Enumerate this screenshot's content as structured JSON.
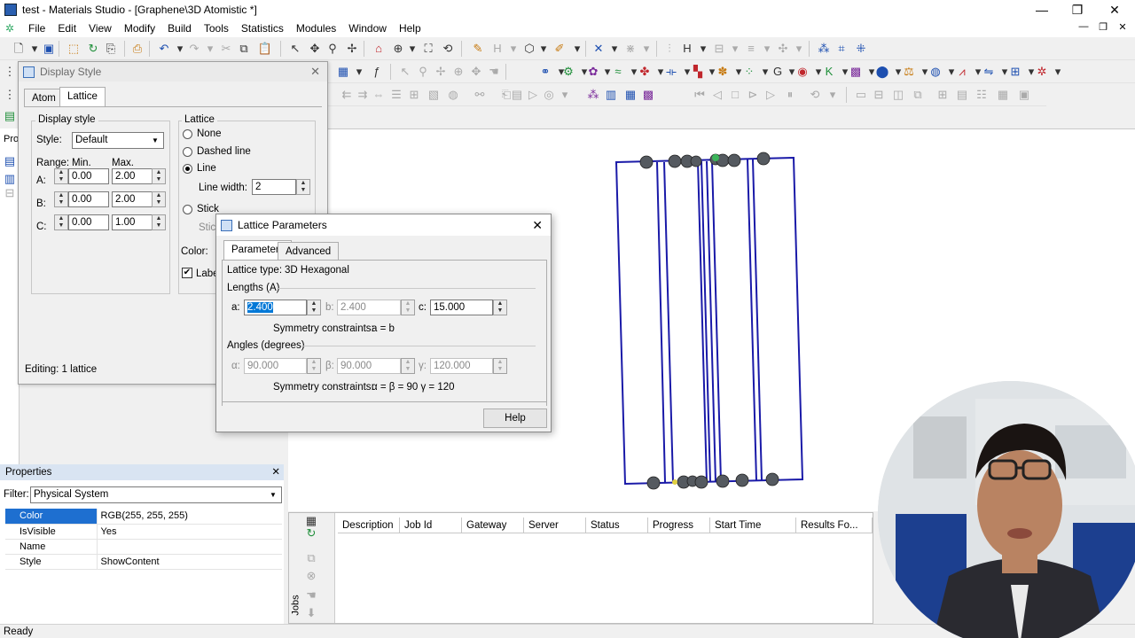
{
  "window": {
    "title": "test - Materials Studio - [Graphene\\3D Atomistic *]"
  },
  "menu": [
    "File",
    "Edit",
    "View",
    "Modify",
    "Build",
    "Tools",
    "Statistics",
    "Modules",
    "Window",
    "Help"
  ],
  "display_style": {
    "title": "Display Style",
    "tabs": [
      "Atom",
      "Lattice"
    ],
    "active_tab": "Lattice",
    "display_style_group": "Display style",
    "style_label": "Style:",
    "style_value": "Default",
    "range_label": "Range:",
    "min_label": "Min.",
    "max_label": "Max.",
    "ranges": [
      {
        "axis": "A:",
        "min": "0.00",
        "max": "2.00"
      },
      {
        "axis": "B:",
        "min": "0.00",
        "max": "2.00"
      },
      {
        "axis": "C:",
        "min": "0.00",
        "max": "1.00"
      }
    ],
    "lattice_group": "Lattice",
    "options": [
      "None",
      "Dashed line",
      "Line",
      "Stick"
    ],
    "selected_option": "Line",
    "line_width_label": "Line width:",
    "line_width": "2",
    "stick_label": "Stic",
    "color_label": "Color:",
    "label_check": "Labe",
    "editing": "Editing: 1 lattice"
  },
  "lattice_params": {
    "title": "Lattice Parameters",
    "tabs": [
      "Parameters",
      "Advanced"
    ],
    "active_tab": "Parameters",
    "lattice_type_label": "Lattice type:",
    "lattice_type": "3D Hexagonal",
    "lengths_label": "Lengths (A)",
    "a_label": "a:",
    "a": "2.400",
    "b_label": "b:",
    "b": "2.400",
    "c_label": "c:",
    "c": "15.000",
    "sym_label": "Symmetry constraints:",
    "sym_lengths": "a = b",
    "angles_label": "Angles (degrees)",
    "alpha_label": "α:",
    "alpha": "90.000",
    "beta_label": "β:",
    "beta": "90.000",
    "gamma_label": "γ:",
    "gamma": "120.000",
    "sym_angles": "α = β = 90  γ = 120",
    "help": "Help"
  },
  "properties": {
    "title": "Properties",
    "filter_label": "Filter:",
    "filter_value": "Physical System",
    "rows": [
      {
        "key": "Color",
        "value": "RGB(255, 255, 255)"
      },
      {
        "key": "IsVisible",
        "value": "Yes"
      },
      {
        "key": "Name",
        "value": ""
      },
      {
        "key": "Style",
        "value": "ShowContent"
      }
    ]
  },
  "left_pane": {
    "pro_label": "Pro"
  },
  "jobs": {
    "side_label": "Jobs",
    "columns": [
      "Description",
      "Job Id",
      "Gateway",
      "Server",
      "Status",
      "Progress",
      "Start Time",
      "Results Fo..."
    ]
  },
  "status": "Ready",
  "colors": {
    "lattice_line": "#1a1aa8",
    "atom": "#555a60",
    "selection": "#1e6fd0"
  }
}
